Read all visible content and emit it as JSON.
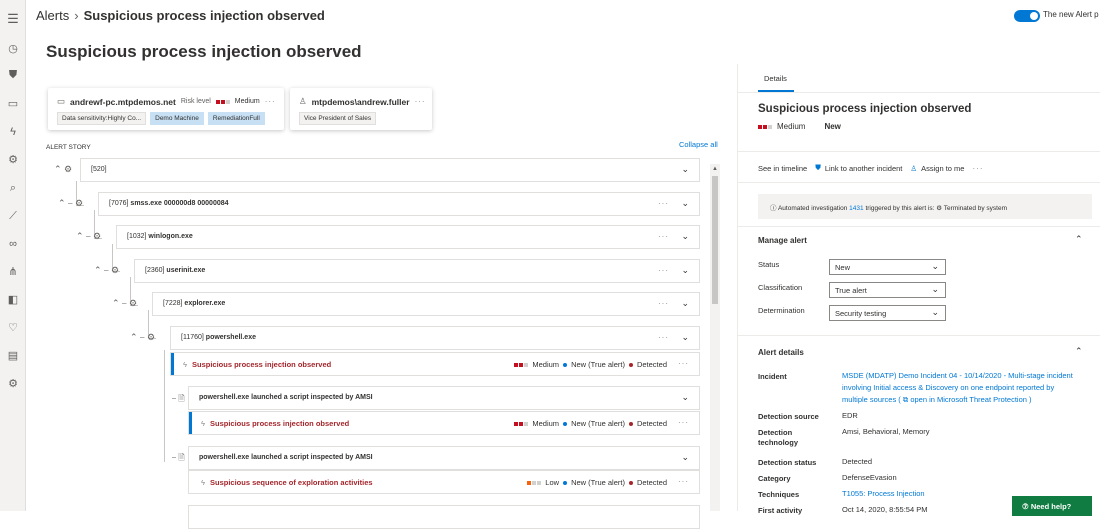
{
  "breadcrumb": {
    "root": "Alerts",
    "current": "Suspicious process injection observed"
  },
  "toggle_label": "The new Alert p",
  "page_title": "Suspicious process injection observed",
  "device_card": {
    "name": "andrewf-pc.mtpdemos.net",
    "risk_label": "Risk level",
    "risk_value": "Medium",
    "tags": [
      "Data sensitivity:Highly Co...",
      "Demo Machine",
      "RemediationFull"
    ]
  },
  "user_card": {
    "name": "mtpdemos\\andrew.fuller",
    "tags": [
      "Vice President of Sales"
    ]
  },
  "story": {
    "label": "ALERT STORY",
    "collapse": "Collapse all",
    "rows": [
      {
        "pid": "[520]",
        "name": ""
      },
      {
        "pid": "[7076]",
        "name": "smss.exe 000000d8 00000084"
      },
      {
        "pid": "[1032]",
        "name": "winlogon.exe"
      },
      {
        "pid": "[2360]",
        "name": "userinit.exe"
      },
      {
        "pid": "[7228]",
        "name": "explorer.exe"
      },
      {
        "pid": "[11760]",
        "name": "powershell.exe"
      }
    ],
    "alerts": [
      {
        "title": "Suspicious process injection observed",
        "severity": "Medium",
        "status": "New (True alert)",
        "detection": "Detected"
      },
      {
        "title": "Suspicious process injection observed",
        "severity": "Medium",
        "status": "New (True alert)",
        "detection": "Detected"
      },
      {
        "title": "Suspicious sequence of exploration activities",
        "severity": "Low",
        "status": "New (True alert)",
        "detection": "Detected"
      }
    ],
    "events": [
      {
        "text": "powershell.exe launched a script inspected by AMSI"
      },
      {
        "text": "powershell.exe launched a script inspected by AMSI"
      }
    ]
  },
  "panel": {
    "tab": "Details",
    "title": "Suspicious process injection observed",
    "severity": "Medium",
    "status": "New",
    "actions": {
      "timeline": "See in timeline",
      "link": "Link to another incident",
      "assign": "Assign to me"
    },
    "auto": {
      "prefix": "Automated investigation",
      "id": "1431",
      "mid": "triggered by this alert is:",
      "state": "Terminated by system"
    },
    "manage": {
      "title": "Manage alert",
      "status_label": "Status",
      "status_value": "New",
      "class_label": "Classification",
      "class_value": "True alert",
      "det_label": "Determination",
      "det_value": "Security testing"
    },
    "details": {
      "title": "Alert details",
      "incident_label": "Incident",
      "incident_line1": "MSDE (MDATP) Demo Incident 04 - 10/14/2020 - Multi-stage incident",
      "incident_line2": "involving Initial access & Discovery on one endpoint reported by",
      "incident_line3a": "multiple sources (",
      "incident_line3b": "open in Microsoft Threat Protection )",
      "source_label": "Detection source",
      "source_value": "EDR",
      "tech_label1": "Detection",
      "tech_label2": "technology",
      "tech_value": "Amsi, Behavioral, Memory",
      "dstatus_label": "Detection status",
      "dstatus_value": "Detected",
      "cat_label": "Category",
      "cat_value": "DefenseEvasion",
      "techniques_label": "Techniques",
      "techniques_value": "T1055: Process Injection",
      "first_label": "First activity",
      "first_value": "Oct 14, 2020, 8:55:54 PM"
    },
    "help": "Need help?"
  }
}
